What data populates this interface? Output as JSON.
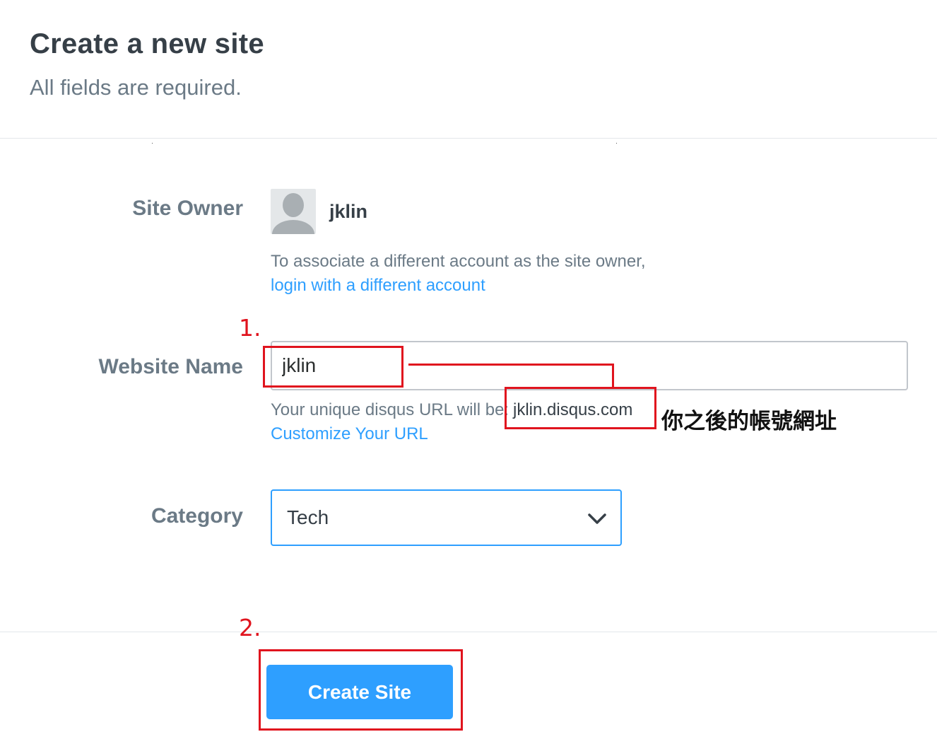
{
  "header": {
    "title": "Create a new site",
    "subtitle": "All fields are required."
  },
  "owner": {
    "label": "Site Owner",
    "username": "jklin",
    "help_text": "To associate a different account as the site owner,",
    "switch_link": "login with a different account"
  },
  "website_name": {
    "label": "Website Name",
    "value": "jklin",
    "url_prefix_text": "Your unique disqus URL will be:",
    "url_value": "jklin.disqus.com",
    "customize_link": "Customize Your URL"
  },
  "category": {
    "label": "Category",
    "selected": "Tech"
  },
  "actions": {
    "create_label": "Create Site"
  },
  "annotations": {
    "step1": "1.",
    "step2": "2.",
    "url_note": "你之後的帳號網址"
  },
  "colors": {
    "accent": "#2e9fff",
    "annotation_red": "#e0141e",
    "label_gray": "#6b7a86",
    "heading": "#363f47"
  },
  "icons": {
    "avatar": "default-avatar-icon",
    "select_arrow": "chevron-down-icon"
  }
}
